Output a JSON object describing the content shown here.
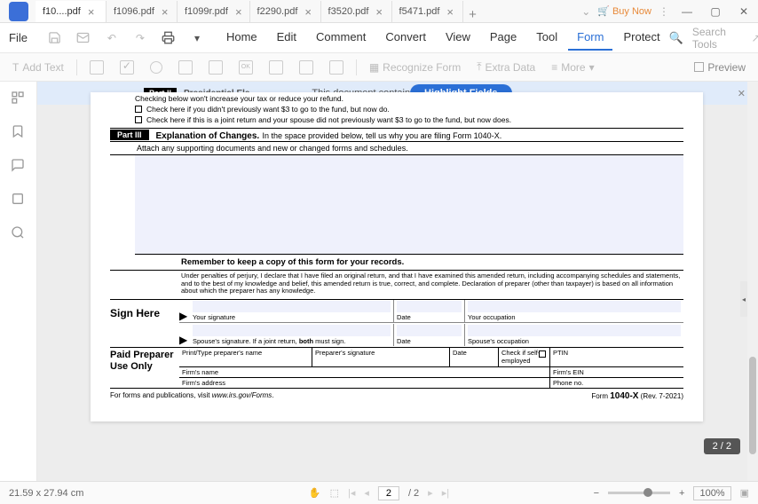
{
  "app": {
    "buy_now": "Buy Now"
  },
  "tabs": [
    {
      "label": "f10....pdf",
      "active": true
    },
    {
      "label": "f1096.pdf"
    },
    {
      "label": "f1099r.pdf"
    },
    {
      "label": "f2290.pdf"
    },
    {
      "label": "f3520.pdf"
    },
    {
      "label": "f5471.pdf"
    }
  ],
  "menubar": {
    "file": "File",
    "items": [
      "Home",
      "Edit",
      "Comment",
      "Convert",
      "View",
      "Page",
      "Tool",
      "Form",
      "Protect"
    ],
    "active": "Form",
    "search_placeholder": "Search Tools"
  },
  "toolbar": {
    "add_text": "Add Text",
    "recognize": "Recognize Form",
    "extra_data": "Extra Data",
    "more": "More",
    "preview": "Preview"
  },
  "notice": {
    "part2_badge": "Part II",
    "part2_title": "Presidential Ele",
    "xfa_msg": "This document contains XFA form fields",
    "highlight_btn": "Highlight Fields"
  },
  "form": {
    "checking_line": "Checking below won't increase your tax or reduce your refund.",
    "check1": "Check here if you didn't previously want $3 to go to the fund, but now do.",
    "check2": "Check here if this is a joint return and your spouse did not previously want $3 to go to the fund, but now does.",
    "part3_badge": "Part III",
    "part3_title": "Explanation of Changes.",
    "part3_desc": "In the space provided below, tell us why you are filing Form 1040-X.",
    "attach": "Attach any supporting documents and new or changed forms and schedules.",
    "keep_copy": "Remember to keep a copy of this form for your records.",
    "perjury": "Under penalties of perjury, I declare that I have filed an original return, and that I have examined this amended return, including accompanying schedules and statements, and to the best of my knowledge and belief, this amended return is true, correct, and complete. Declaration of preparer (other than taxpayer) is based on all information about which the preparer has any knowledge.",
    "sign_here": "Sign Here",
    "your_sig": "Your signature",
    "date": "Date",
    "your_occ": "Your occupation",
    "spouse_sig_full": "Spouse's signature. If a joint return, ",
    "both": "both",
    "must_sign": " must sign.",
    "spouse_occ": "Spouse's occupation",
    "paid_prep": "Paid Preparer Use Only",
    "prep_name": "Print/Type preparer's name",
    "prep_sig": "Preparer's signature",
    "prep_date": "Date",
    "check_self": "Check         if self-employed",
    "ptin": "PTIN",
    "firm_name": "Firm's name",
    "firm_ein": "Firm's EIN",
    "firm_addr": "Firm's address",
    "phone": "Phone no.",
    "footer_left": "For forms and publications, visit ",
    "footer_left_i": "www.irs.gov/Forms",
    "footer_right_pre": "Form ",
    "footer_form": "1040-X",
    "footer_rev": " (Rev. 7-2021)"
  },
  "pagebadge": "2 / 2",
  "status": {
    "dims": "21.59 x 27.94 cm",
    "page_current": "2",
    "page_total": "/ 2",
    "zoom": "100%"
  }
}
